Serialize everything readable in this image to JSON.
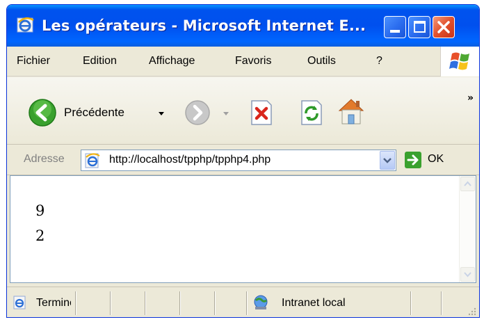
{
  "window": {
    "title": "Les opérateurs - Microsoft Internet E..."
  },
  "menu": {
    "items": [
      "Fichier",
      "Edition",
      "Affichage",
      "Favoris",
      "Outils",
      "?"
    ]
  },
  "toolbar": {
    "back_label": "Précédente"
  },
  "address": {
    "label": "Adresse",
    "url": "http://localhost/tpphp/tpphp4.php",
    "go_label": "OK"
  },
  "content": {
    "lines": [
      "9",
      "2"
    ]
  },
  "status": {
    "text": "Terminé",
    "zone": "Intranet local"
  },
  "colors": {
    "titlebar": "#0054e3",
    "chrome": "#ece9d8",
    "close_button": "#e2502c",
    "back_arrow": "#3aa12e"
  }
}
